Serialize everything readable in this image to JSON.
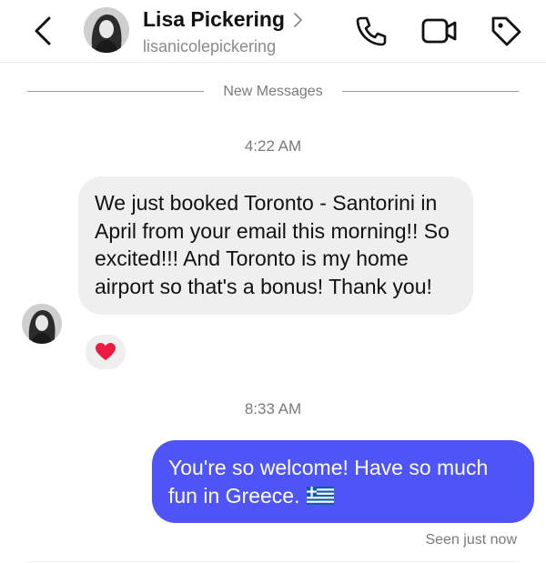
{
  "header": {
    "contact_name": "Lisa Pickering",
    "username": "lisanicolepickering"
  },
  "thread": {
    "new_messages_label": "New Messages",
    "messages": [
      {
        "timestamp": "4:22 AM",
        "direction": "incoming",
        "text": "We just booked Toronto - Santorini in April from your email this morning!! So excited!!! And Toronto is my home airport so that's a bonus!  Thank you!",
        "reaction": "❤️"
      },
      {
        "timestamp": "8:33 AM",
        "direction": "outgoing",
        "text": "You're so welcome! Have so much fun in Greece.",
        "flag_emoji": "🇬🇷"
      }
    ],
    "seen_status": "Seen just now"
  },
  "icons": {
    "back": "back-arrow-icon",
    "chevron": "chevron-right-icon",
    "call": "phone-icon",
    "video": "video-camera-icon",
    "tag": "tag-icon"
  },
  "colors": {
    "outgoing_bubble": "#4e54f5",
    "incoming_bubble": "#efefef",
    "muted_text": "#7a7a7a"
  }
}
